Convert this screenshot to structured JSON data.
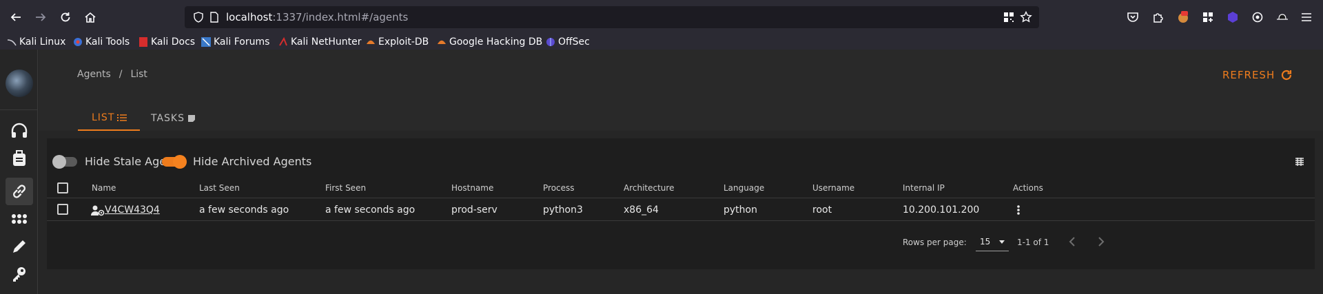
{
  "browser": {
    "url_host": "localhost",
    "url_rest": ":1337/index.html#/agents",
    "bookmarks": [
      "Kali Linux",
      "Kali Tools",
      "Kali Docs",
      "Kali Forums",
      "Kali NetHunter",
      "Exploit-DB",
      "Google Hacking DB",
      "OffSec"
    ]
  },
  "header": {
    "breadcrumb": [
      "Agents",
      "List"
    ],
    "breadcrumb_sep": "/",
    "refresh_label": "REFRESH",
    "tabs": [
      {
        "label": "LIST",
        "active": true
      },
      {
        "label": "TASKS",
        "active": false
      }
    ]
  },
  "filters": {
    "hide_stale": {
      "label": "Hide Stale Agents",
      "on": false
    },
    "hide_archived": {
      "label": "Hide Archived Agents",
      "on": true
    }
  },
  "table": {
    "columns": [
      "Name",
      "Last Seen",
      "First Seen",
      "Hostname",
      "Process",
      "Architecture",
      "Language",
      "Username",
      "Internal IP",
      "Actions"
    ],
    "rows": [
      {
        "name": "V4CW43Q4",
        "last_seen": "a few seconds ago",
        "first_seen": "a few seconds ago",
        "hostname": "prod-serv",
        "process": "python3",
        "architecture": "x86_64",
        "language": "python",
        "username": "root",
        "internal_ip": "10.200.101.200"
      }
    ]
  },
  "pagination": {
    "rows_per_page_label": "Rows per page:",
    "rows_per_page": "15",
    "range": "1-1 of 1"
  },
  "colors": {
    "accent": "#ee7c1d",
    "background": "#1e1e1e",
    "panel": "#292929"
  }
}
